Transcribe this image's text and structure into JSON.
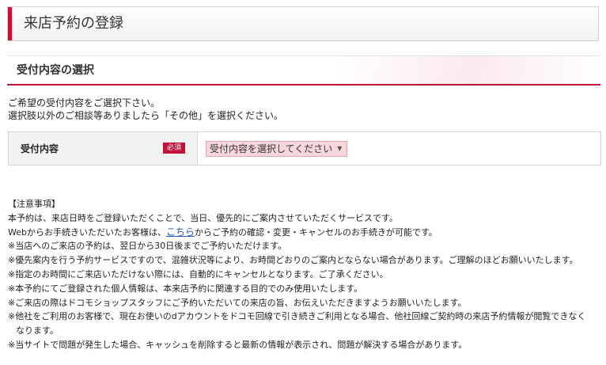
{
  "header": {
    "title": "来店予約の登録"
  },
  "section": {
    "title": "受付内容の選択"
  },
  "intro": {
    "line1": "ご希望の受付内容をご選択下さい。",
    "line2": "選択肢以外のご相談等ありましたら「その他」を選択ください。"
  },
  "form": {
    "label": "受付内容",
    "required": "必須",
    "select_value": "受付内容を選択してください"
  },
  "notes": {
    "heading": "【注意事項】",
    "line1": "本予約は、来店日時をご登録いただくことで、当日、優先的にご案内させていただくサービスです。",
    "line2_prefix": "Webからお手続きいただいたお客様は、",
    "line2_link": "こちら",
    "line2_suffix": "からご予約の確認・変更・キャンセルのお手続きが可能です。",
    "line3": "※当店へのご来店の予約は、翌日から30日後までご予約いただけます。",
    "line4": "※優先案内を行う予約サービスですので、混雑状況等により、お時間どおりのご案内とならない場合があります。ご理解のほどお願いいたします。",
    "line5": "※指定のお時間にご来店いただけない際には、自動的にキャンセルとなります。ご了承ください。",
    "line6": "※本予約にてご登録された個人情報は、本来店予約に関連する目的でのみ使用いたします。",
    "line7": "※ご来店の際はドコモショップスタッフにご予約いただいての来店の旨、お伝えいただきますようお願いいたします。",
    "line8a": "※他社をご利用のお客様で、現在お使いのdアカウントをドコモ回線で引き続きご利用となる場合、他社回線ご契約時の来店予約情報が閲覧できなく",
    "line8b": "なります。",
    "line9": "※当サイトで問題が発生した場合、キャッシュを削除すると最新の情報が表示され、問題が解決する場合があります。"
  },
  "colors": {
    "accent": "#c4113a",
    "select_bg": "#f7d6dc",
    "link": "#1e5ab8"
  }
}
